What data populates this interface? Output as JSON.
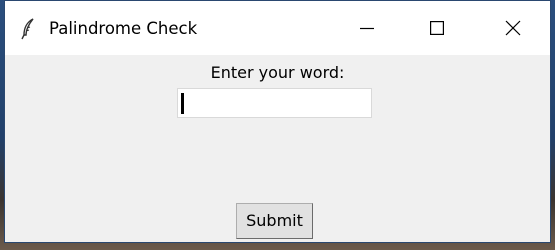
{
  "window": {
    "title": "Palindrome Check",
    "app_icon": "feather-icon",
    "controls": {
      "minimize_icon": "minimize-icon",
      "maximize_icon": "maximize-icon",
      "close_icon": "close-icon"
    }
  },
  "form": {
    "prompt": "Enter your word:",
    "input_value": "",
    "submit_label": "Submit"
  },
  "colors": {
    "titlebar": "#ffffff",
    "window_bg": "#f0f0f0",
    "button_bg": "#e1e1e1"
  }
}
